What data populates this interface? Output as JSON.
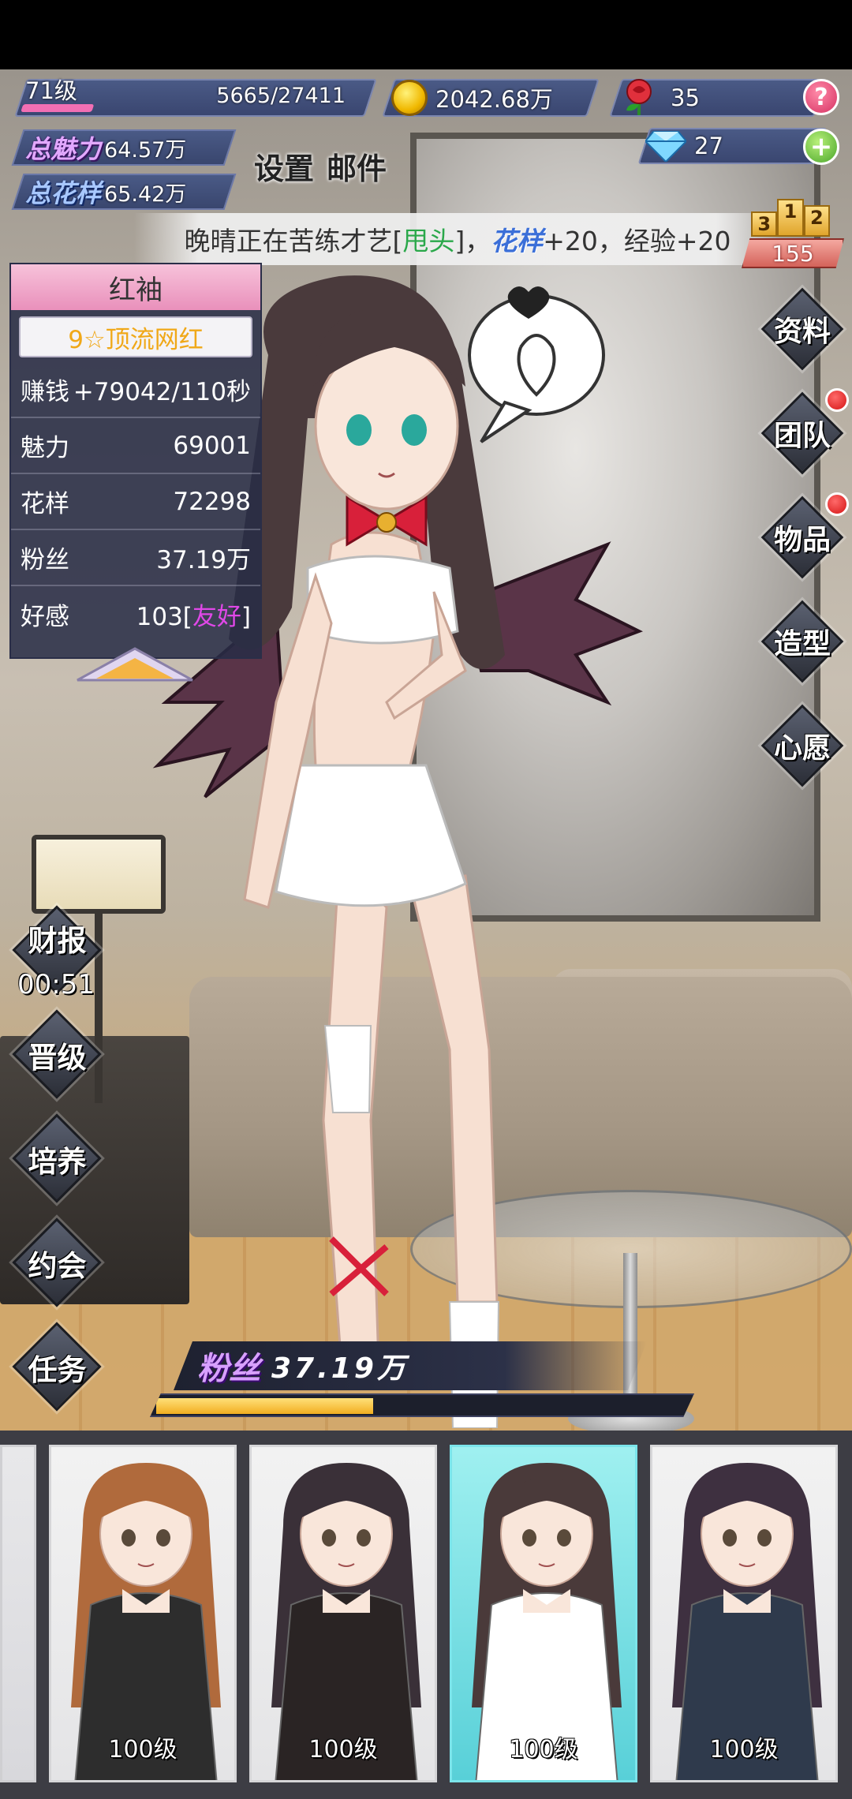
{
  "player": {
    "level": "71级",
    "xp": "5665/27411",
    "xp_fraction": 0.21
  },
  "currency": {
    "gold": "2042.68万",
    "roses": "35",
    "diamonds": "27"
  },
  "stats": {
    "charm_label": "总魅力",
    "charm_value": "64.57万",
    "style_label": "总花样",
    "style_value": "65.42万"
  },
  "top_links": {
    "settings": "设置",
    "mail": "邮件"
  },
  "banner": {
    "prefix": "晚晴正在苦练才艺[",
    "skill": "甩头",
    "mid": "]，",
    "attr": "花样",
    "suffix": "+20，经验+20"
  },
  "ranking": {
    "podium": [
      "3",
      "1",
      "2"
    ],
    "rank": "155"
  },
  "girl_panel": {
    "name": "红袖",
    "title": "9☆顶流网红",
    "rows": [
      {
        "label": "赚钱",
        "value": "+79042/110秒"
      },
      {
        "label": "魅力",
        "value": "69001"
      },
      {
        "label": "花样",
        "value": "72298"
      },
      {
        "label": "粉丝",
        "value": "37.19万"
      },
      {
        "label": "好感",
        "value_prefix": "103[",
        "value_highlight": "友好",
        "value_suffix": "]"
      }
    ]
  },
  "right_menu": [
    {
      "label": "资料",
      "badge": false
    },
    {
      "label": "团队",
      "badge": true
    },
    {
      "label": "物品",
      "badge": true
    },
    {
      "label": "造型",
      "badge": false
    },
    {
      "label": "心愿",
      "badge": false
    }
  ],
  "left_menu": [
    {
      "label": "财报"
    },
    {
      "label": "晋级"
    },
    {
      "label": "培养"
    },
    {
      "label": "约会"
    },
    {
      "label": "任务"
    }
  ],
  "report_timer": "00:51",
  "fans_bar": {
    "label": "粉丝",
    "value": "37.19万",
    "fraction": 0.41
  },
  "roster": [
    {
      "level": "100级",
      "hair": "#b06a3c",
      "outfit": "#2d2d2d",
      "selected": false
    },
    {
      "level": "100级",
      "hair": "#3a3038",
      "outfit": "#2a2424",
      "selected": false
    },
    {
      "level": "100级",
      "hair": "#4a3a3a",
      "outfit": "#ffffff",
      "selected": true
    },
    {
      "level": "100级",
      "hair": "#3e3040",
      "outfit": "#2f3a4c",
      "selected": false
    }
  ],
  "colors": {
    "accent_pink": "#e990bb",
    "panel_bg": "#282c46",
    "gold": "#f0b800",
    "highlight_purple": "#e048e8",
    "skill_green": "#2aa84a"
  }
}
